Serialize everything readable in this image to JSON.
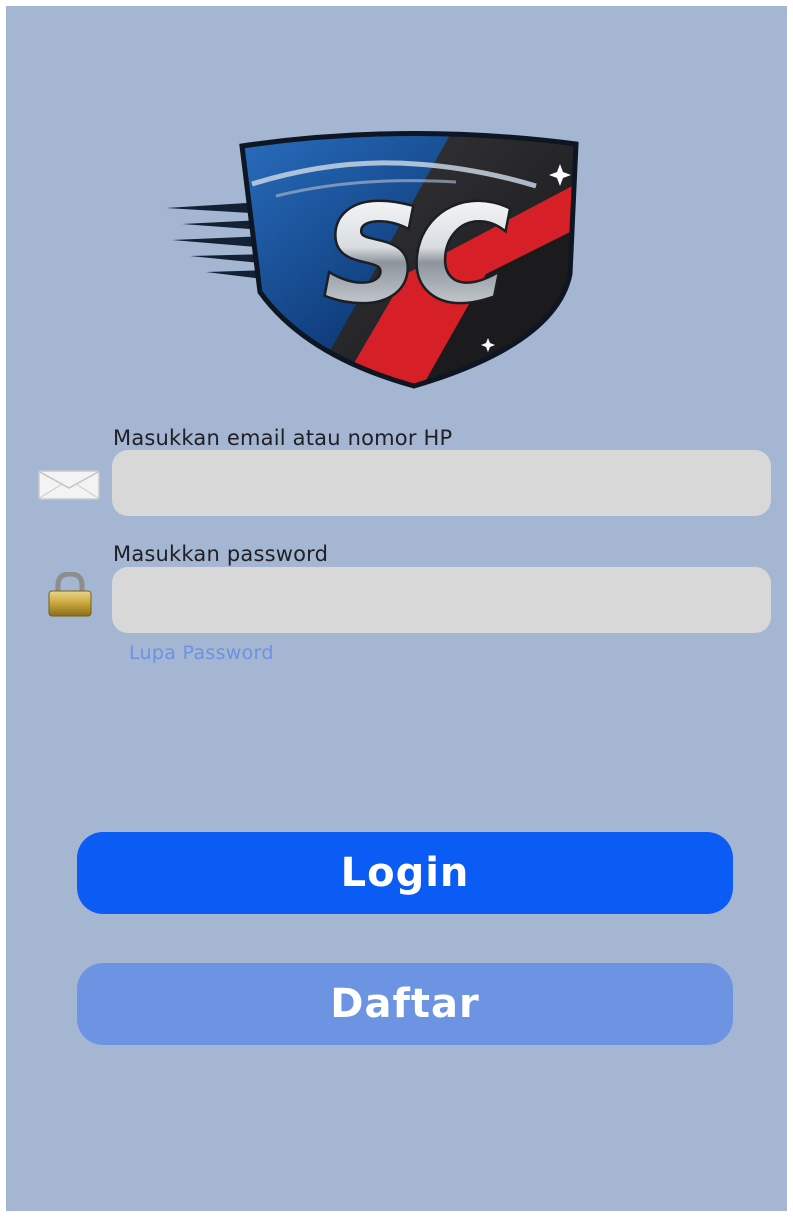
{
  "logo": {
    "text": "SC"
  },
  "email": {
    "label": "Masukkan email atau nomor HP",
    "value": "",
    "placeholder": "",
    "icon": "envelope-icon"
  },
  "password": {
    "label": "Masukkan password",
    "value": "",
    "placeholder": "",
    "icon": "padlock-icon"
  },
  "forgot_password_label": "Lupa Password",
  "login_label": "Login",
  "register_label": "Daftar",
  "colors": {
    "background": "#a5b6d2",
    "login_button": "#0b5cf5",
    "register_button": "#6c94e2",
    "input_background": "#d8d8d8",
    "link": "#6a93e6"
  }
}
